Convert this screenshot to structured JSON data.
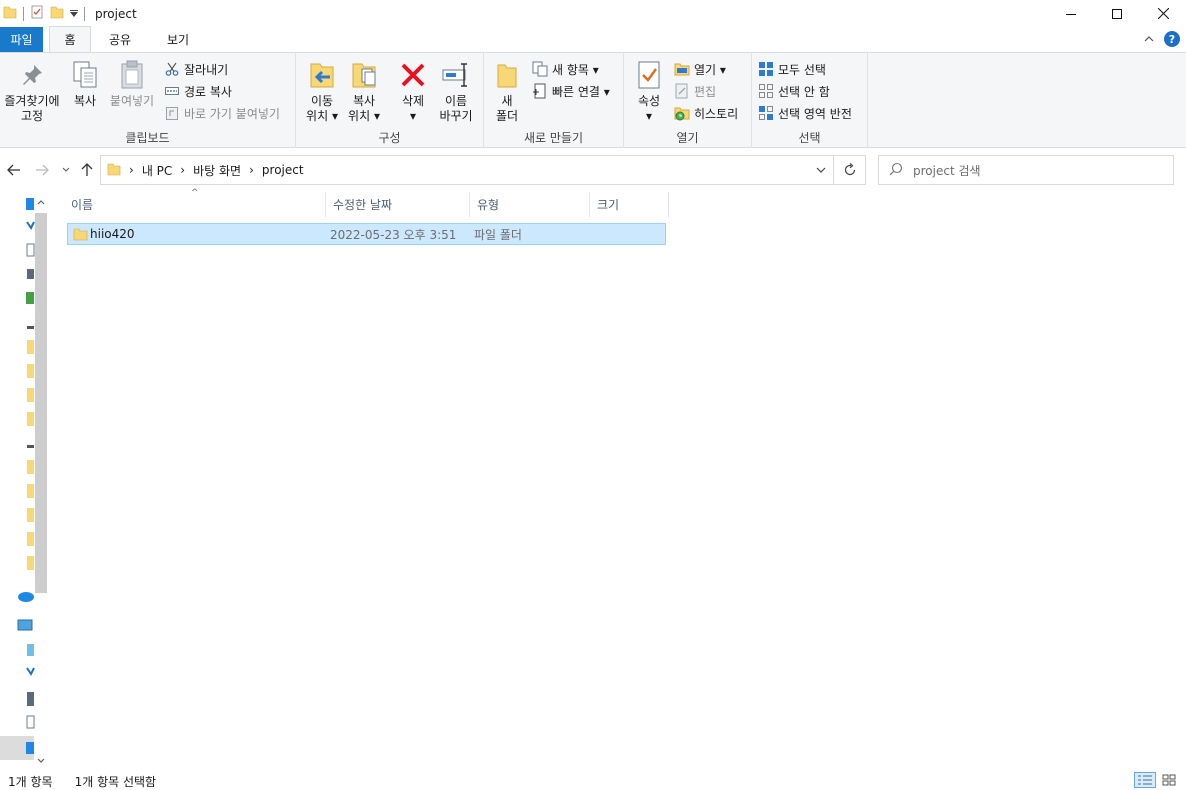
{
  "window": {
    "title": "project"
  },
  "tabs": {
    "file": "파일",
    "home": "홈",
    "share": "공유",
    "view": "보기"
  },
  "ribbon": {
    "clipboard": {
      "label": "클립보드",
      "pin_line1": "즐겨찾기에",
      "pin_line2": "고정",
      "copy": "복사",
      "paste": "붙여넣기",
      "cut": "잘라내기",
      "copy_path": "경로 복사",
      "paste_shortcut": "바로 가기 붙여넣기"
    },
    "organize": {
      "label": "구성",
      "move_line1": "이동",
      "move_line2": "위치",
      "copy_line1": "복사",
      "copy_line2": "위치",
      "delete": "삭제",
      "rename_line1": "이름",
      "rename_line2": "바꾸기"
    },
    "new": {
      "label": "새로 만들기",
      "new_folder_line1": "새",
      "new_folder_line2": "폴더",
      "new_item": "새 항목",
      "easy_access": "빠른 연결"
    },
    "open": {
      "label": "열기",
      "properties": "속성",
      "open": "열기",
      "edit": "편집",
      "history": "히스토리"
    },
    "select": {
      "label": "선택",
      "select_all": "모두 선택",
      "select_none": "선택 안 함",
      "invert": "선택 영역 반전"
    }
  },
  "address": {
    "crumbs": [
      "내 PC",
      "바탕 화면",
      "project"
    ]
  },
  "search": {
    "placeholder": "project 검색"
  },
  "columns": {
    "name": "이름",
    "date": "수정한 날짜",
    "type": "유형",
    "size": "크기"
  },
  "files": [
    {
      "name": "hiio420",
      "date": "2022-05-23 오후 3:51",
      "type": "파일 폴더",
      "size": ""
    }
  ],
  "status": {
    "count": "1개 항목",
    "selected": "1개 항목 선택함"
  },
  "colors": {
    "accent": "#1979ca",
    "folder": "#f8d775",
    "selection": "#cce8ff",
    "delete": "#e81123"
  }
}
